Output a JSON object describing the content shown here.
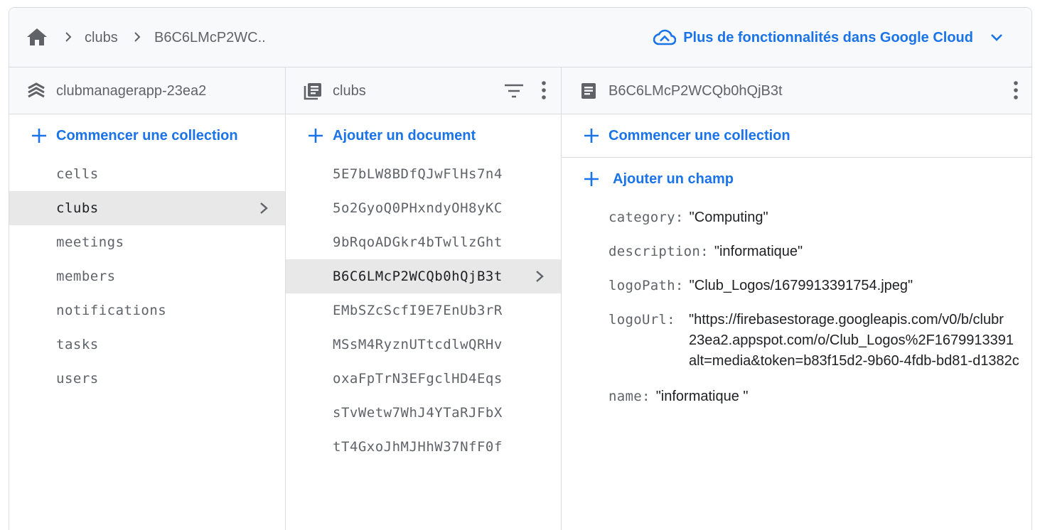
{
  "breadcrumb": {
    "items": [
      "clubs",
      "B6C6LMcP2WC.."
    ]
  },
  "gcloud": {
    "label": "Plus de fonctionnalités dans Google Cloud"
  },
  "panels": {
    "root": {
      "title": "clubmanagerapp-23ea2",
      "add_label": "Commencer une collection",
      "items": [
        "cells",
        "clubs",
        "meetings",
        "members",
        "notifications",
        "tasks",
        "users"
      ],
      "selected": "clubs"
    },
    "collection": {
      "title": "clubs",
      "add_label": "Ajouter un document",
      "items": [
        "5E7bLW8BDfQJwFlHs7n4",
        "5o2GyoQ0PHxndyOH8yKC",
        "9bRqoADGkr4bTwllzGht",
        "B6C6LMcP2WCQb0hQjB3t",
        "EMbSZcScfI9E7EnUb3rR",
        "MSsM4RyznUTtcdlwQRHv",
        "oxaFpTrN3EFgclHD4Eqs",
        "sTvWetw7WhJ4YTaRJFbX",
        "tT4GxoJhMJHhW37NfF0f"
      ],
      "selected": "B6C6LMcP2WCQb0hQjB3t"
    },
    "document": {
      "title": "B6C6LMcP2WCQb0hQjB3t",
      "add_collection_label": "Commencer une collection",
      "add_field_label": "Ajouter un champ",
      "fields": {
        "category": {
          "key": "category:",
          "value": "\"Computing\""
        },
        "description": {
          "key": "description:",
          "value": "\"informatique\""
        },
        "logoPath": {
          "key": "logoPath:",
          "value": "\"Club_Logos/1679913391754.jpeg\""
        },
        "logoUrl": {
          "key": "logoUrl:",
          "lines": [
            "\"https://firebasestorage.googleapis.com/v0/b/clubr",
            "23ea2.appspot.com/o/Club_Logos%2F1679913391",
            "alt=media&token=b83f15d2-9b60-4fdb-bd81-d1382c"
          ]
        },
        "name": {
          "key": "name:",
          "value": "\"informatique \""
        }
      }
    }
  },
  "colors": {
    "accent": "#1a73e8",
    "selected_bg": "#e8e8e8",
    "header_bg": "#f8f9fa",
    "muted_text": "#5f6368"
  },
  "icons": {
    "home": "home-icon",
    "cloud": "cloud-icon",
    "expand": "chevron-down-icon",
    "root": "firestore-stack-icon",
    "collection": "collection-icon",
    "document": "document-icon",
    "filter": "filter-icon",
    "more": "more-vert-icon",
    "add": "plus-icon",
    "chevron": "chevron-right-icon"
  }
}
